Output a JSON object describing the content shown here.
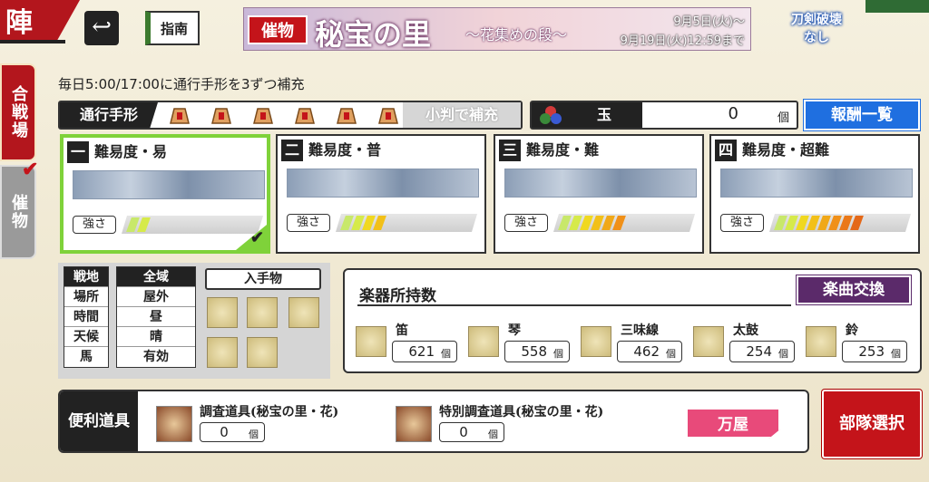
{
  "corner": {
    "title": "陣"
  },
  "side": {
    "tab1": "合戦場",
    "tab2": "催物"
  },
  "top": {
    "guide": "指南",
    "back": "↩"
  },
  "banner": {
    "tag": "催物",
    "title": "秘宝の里",
    "subtitle": "〜花集めの段〜",
    "date_start": "9月5日(火)〜",
    "date_end": "9月19日(火)12:59まで"
  },
  "no_break": {
    "line1": "刀剣破壊",
    "line2": "なし"
  },
  "info": "毎日5:00/17:00に通行手形を3ずつ補充",
  "pass": {
    "label": "通行手形",
    "count": 6,
    "koban": "小判で補充"
  },
  "gem": {
    "label": "玉",
    "value": "0",
    "unit": "個"
  },
  "reward_button": "報酬一覧",
  "strength_label": "強さ",
  "difficulties": [
    {
      "num": "一",
      "label": "難易度・易",
      "level": 2,
      "selected": true
    },
    {
      "num": "二",
      "label": "難易度・普",
      "level": 4,
      "selected": false
    },
    {
      "num": "三",
      "label": "難易度・難",
      "level": 6,
      "selected": false
    },
    {
      "num": "四",
      "label": "難易度・超難",
      "level": 8,
      "selected": false
    }
  ],
  "conditions": {
    "keys": [
      "戦地",
      "場所",
      "時間",
      "天候",
      "馬"
    ],
    "values": [
      "全域",
      "屋外",
      "昼",
      "晴",
      "有効"
    ]
  },
  "acquire": {
    "label": "入手物"
  },
  "instruments": {
    "title": "楽器所持数",
    "exchange": "楽曲交換",
    "items": [
      {
        "name": "笛",
        "count": "621",
        "unit": "個"
      },
      {
        "name": "琴",
        "count": "558",
        "unit": "個"
      },
      {
        "name": "三味線",
        "count": "462",
        "unit": "個"
      },
      {
        "name": "太鼓",
        "count": "254",
        "unit": "個"
      },
      {
        "name": "鈴",
        "count": "253",
        "unit": "個"
      }
    ]
  },
  "tools": {
    "label": "便利道具",
    "items": [
      {
        "name": "調査道具(秘宝の里・花)",
        "count": "0",
        "unit": "個"
      },
      {
        "name": "特別調査道具(秘宝の里・花)",
        "count": "0",
        "unit": "個"
      }
    ]
  },
  "shop": "万屋",
  "squad": "部隊選択",
  "colors": {
    "accent_red": "#c4141a",
    "selected_green": "#7fd23a",
    "reward_blue": "#1f6fe0",
    "exchange_purple": "#5b2a6a"
  }
}
